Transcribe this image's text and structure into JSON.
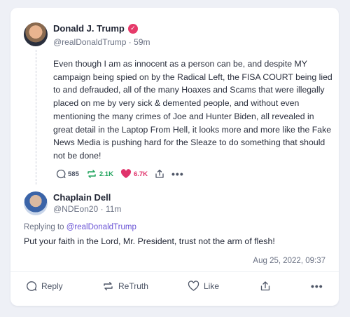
{
  "post": {
    "author": {
      "display_name": "Donald J. Trump",
      "handle": "@realDonaldTrump",
      "time_ago": "59m",
      "verified_icon": "verified-check-icon"
    },
    "text": "Even though I am as innocent as a person can be, and despite MY campaign being spied on by the Radical Left, the FISA COURT being lied to and defrauded, all of the many Hoaxes and Scams that were illegally placed on me by very sick & demented people, and without even mentioning the many crimes of Joe and Hunter Biden, all revealed in great detail in the Laptop From Hell, it looks more and more like the Fake News Media is pushing hard for the Sleaze to do something that should not be done!",
    "stats": {
      "replies": "585",
      "retruths": "2.1K",
      "likes": "6.7K"
    }
  },
  "reply": {
    "author": {
      "display_name": "Chaplain Dell",
      "handle": "@NDEon20",
      "time_ago": "11m"
    },
    "replying_prefix": "Replying to",
    "replying_to": "@realDonaldTrump",
    "text": "Put your faith in the Lord, Mr. President, trust not the arm of flesh!",
    "timestamp": "Aug 25, 2022, 09:37"
  },
  "actions": {
    "reply_label": "Reply",
    "retruth_label": "ReTruth",
    "like_label": "Like"
  },
  "colors": {
    "accent": "#6b55d6",
    "retruth": "#1fa35c",
    "like": "#e0336b",
    "verified": "#e63a6a"
  }
}
